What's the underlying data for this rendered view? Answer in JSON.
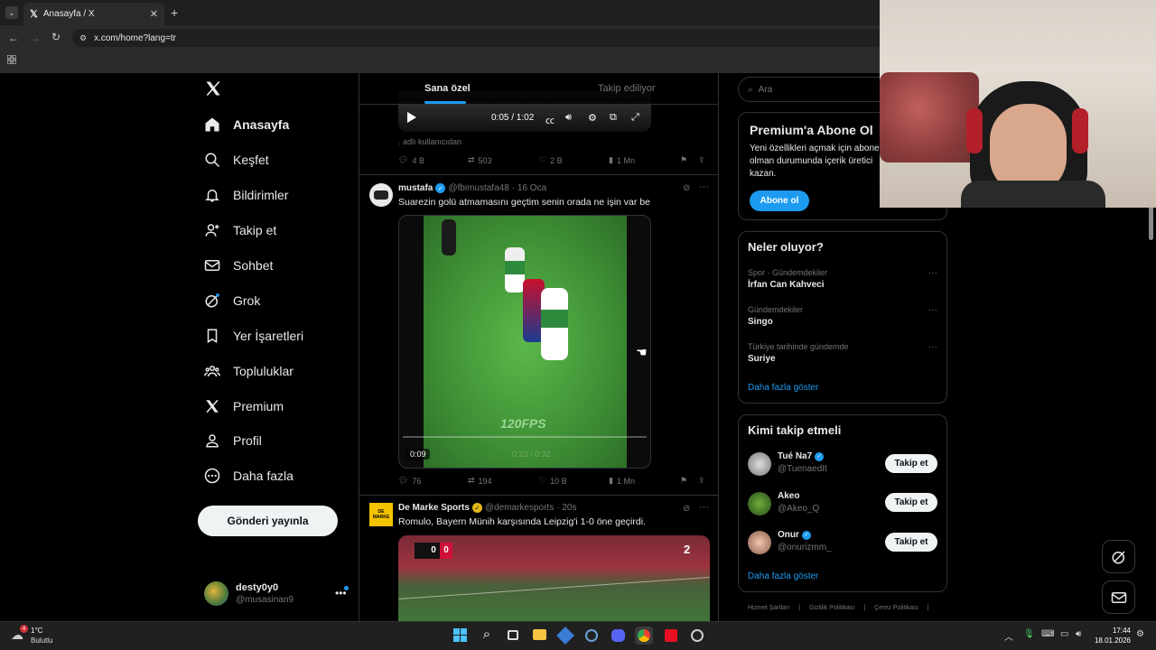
{
  "browser": {
    "tab_title": "Anasayfa / X",
    "url": "x.com/home?lang=tr"
  },
  "nav": {
    "items": [
      {
        "label": "Anasayfa",
        "icon": "home-icon"
      },
      {
        "label": "Keşfet",
        "icon": "search-icon"
      },
      {
        "label": "Bildirimler",
        "icon": "bell-icon"
      },
      {
        "label": "Takip et",
        "icon": "person-add-icon"
      },
      {
        "label": "Sohbet",
        "icon": "mail-icon"
      },
      {
        "label": "Grok",
        "icon": "grok-icon"
      },
      {
        "label": "Yer İşaretleri",
        "icon": "bookmark-icon"
      },
      {
        "label": "Topluluklar",
        "icon": "communities-icon"
      },
      {
        "label": "Premium",
        "icon": "x-logo-icon"
      },
      {
        "label": "Profil",
        "icon": "person-icon"
      },
      {
        "label": "Daha fazla",
        "icon": "more-circle-icon"
      }
    ],
    "post_button": "Gönderi yayınla",
    "account": {
      "name": "desty0y0",
      "handle": "@musasinan9"
    }
  },
  "feed": {
    "tabs": [
      "Sana özel",
      "Takip ediliyor"
    ],
    "video1": {
      "time": "0:05 / 1:02",
      "caption": ". adlı kullanıcıdan",
      "replies": "4 B",
      "reposts": "503",
      "likes": "2 B",
      "views": "1 Mn"
    },
    "post1": {
      "name": "mustafa",
      "handle": "@fbimustafa48",
      "date": "· 16 Oca",
      "text": "Suarezin golü atmamasını geçtim senin orada ne işin var be",
      "video_time": "0:09",
      "video_overlay": "0:23 / 0:32",
      "watermark": "120FPS",
      "replies": "76",
      "reposts": "194",
      "likes": "10 B",
      "views": "1 Mn"
    },
    "post2": {
      "name": "De Marke Sports",
      "handle": "@demarkesports",
      "date": "· 20s",
      "text": "Romulo, Bayern Münih karşısında Leipzig'i 1-0 öne geçirdi.",
      "avatar_text": "DE MARKE",
      "score_left": "0",
      "score_right": "0",
      "overlay_num": "2"
    }
  },
  "right": {
    "search_placeholder": "Ara",
    "premium": {
      "title": "Premium'a Abone Ol",
      "text": "Yeni özellikleri açmak için abone olman durumunda içerik üretici kazan.",
      "button": "Abone ol"
    },
    "trends": {
      "title": "Neler oluyor?",
      "items": [
        {
          "category": "Spor · Gündemdekiler",
          "name": "İrfan Can Kahveci"
        },
        {
          "category": "Gündemdekiler",
          "name": "Singo"
        },
        {
          "category": "Türkiye tarihinde gündemde",
          "name": "Suriye"
        }
      ],
      "more": "Daha fazla göster"
    },
    "who_to_follow": {
      "title": "Kimi takip etmeli",
      "items": [
        {
          "name": "Tué Na7",
          "handle": "@TuenaedIt",
          "button": "Takip et"
        },
        {
          "name": "Akeo",
          "handle": "@Akeo_Q",
          "button": "Takip et"
        },
        {
          "name": "Onur",
          "handle": "@onurizmm_",
          "button": "Takip et"
        }
      ],
      "more": "Daha fazla göster"
    },
    "footer": [
      "Hizmet Şartları",
      "Gizlilik Politikası",
      "Çerez Politikası"
    ]
  },
  "taskbar": {
    "weather_temp": "1°C",
    "weather_text": "Bulutlu",
    "badge": "4",
    "time": "17:44",
    "date": "18.01.2026"
  },
  "colors": {
    "accent": "#1d9bf0",
    "verified_gold": "#e2b719"
  }
}
